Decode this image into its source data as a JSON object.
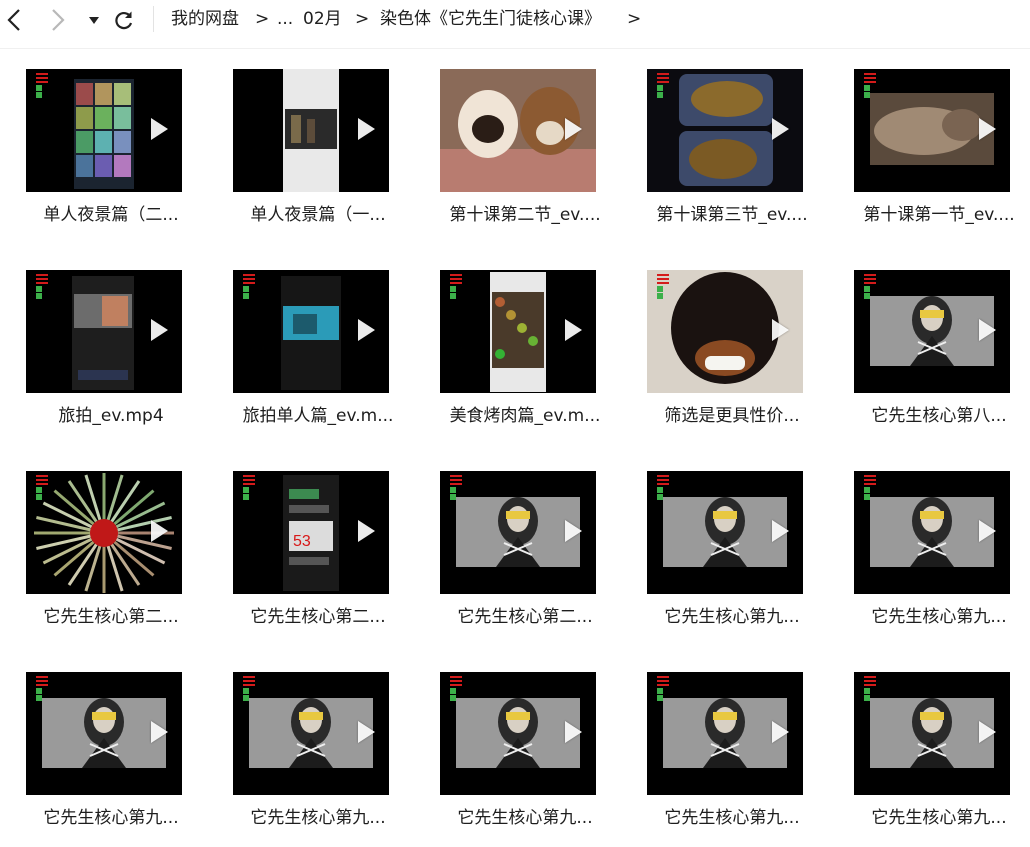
{
  "toolbar": {
    "back_icon": "chevron-left-icon",
    "forward_icon": "chevron-right-icon",
    "history_icon": "caret-down-icon",
    "refresh_icon": "refresh-icon"
  },
  "breadcrumb": {
    "items": [
      "我的网盘",
      "...",
      "02月",
      "染色体《它先生门徒核心课》"
    ],
    "separator": ">"
  },
  "files": [
    {
      "name": "单人夜景篇（二...",
      "thumb": "phone-grid"
    },
    {
      "name": "单人夜景篇（一...",
      "thumb": "phone-white"
    },
    {
      "name": "第十课第二节_ev....",
      "thumb": "dogs"
    },
    {
      "name": "第十课第三节_ev....",
      "thumb": "food-box"
    },
    {
      "name": "第十课第一节_ev....",
      "thumb": "dog-sleeping"
    },
    {
      "name": "旅拍_ev.mp4",
      "thumb": "phone-dark"
    },
    {
      "name": "旅拍单人篇_ev.m...",
      "thumb": "phone-blue"
    },
    {
      "name": "美食烤肉篇_ev.m...",
      "thumb": "phone-food"
    },
    {
      "name": "筛选是更具性价...",
      "thumb": "rottweiler"
    },
    {
      "name": "它先生核心第八...",
      "thumb": "portrait"
    },
    {
      "name": "它先生核心第二...",
      "thumb": "blast"
    },
    {
      "name": "它先生核心第二...",
      "thumb": "phone-chat"
    },
    {
      "name": "它先生核心第二...",
      "thumb": "portrait"
    },
    {
      "name": "它先生核心第九...",
      "thumb": "portrait"
    },
    {
      "name": "它先生核心第九...",
      "thumb": "portrait"
    },
    {
      "name": "它先生核心第九...",
      "thumb": "portrait"
    },
    {
      "name": "它先生核心第九...",
      "thumb": "portrait"
    },
    {
      "name": "它先生核心第九...",
      "thumb": "portrait"
    },
    {
      "name": "它先生核心第九...",
      "thumb": "portrait"
    },
    {
      "name": "它先生核心第九...",
      "thumb": "portrait"
    }
  ],
  "colors": {
    "thumb_bg": "#000000",
    "watermark_red": "#d41b1b",
    "watermark_green": "#3cb04a",
    "text": "#1e1e1e"
  }
}
